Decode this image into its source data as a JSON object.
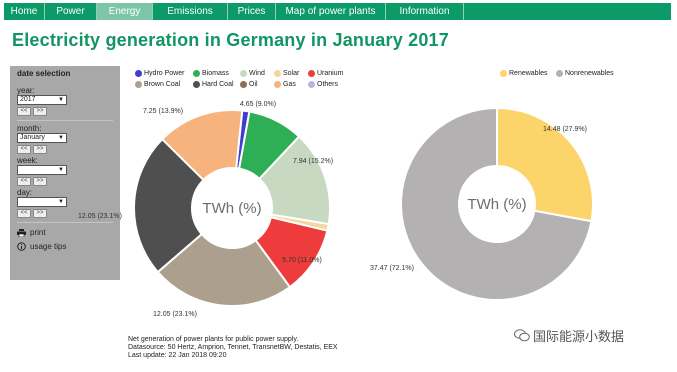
{
  "nav": {
    "items": [
      "Home",
      "Power",
      "Energy",
      "Emissions",
      "Prices",
      "Map of power plants",
      "Information"
    ],
    "active": "Energy"
  },
  "page": {
    "title": "Electricity generation in Germany in January 2017"
  },
  "sidebar": {
    "heading": "date selection",
    "year_label": "year:",
    "year_value": "2017",
    "month_label": "month:",
    "month_value": "January",
    "week_label": "week:",
    "week_value": "",
    "day_label": "day:",
    "day_value": "",
    "prev_label": "<<",
    "next_label": ">>",
    "print_label": "print",
    "usage_label": "usage tips"
  },
  "legend_left": [
    {
      "label": "Hydro Power",
      "color": "#3e3fcf"
    },
    {
      "label": "Biomass",
      "color": "#2eae55"
    },
    {
      "label": "Wind",
      "color": "#c8d9c2"
    },
    {
      "label": "Solar",
      "color": "#f4d79a"
    },
    {
      "label": "Uranium",
      "color": "#ee3b3b"
    },
    {
      "label": "Brown Coal",
      "color": "#ad9f8d"
    },
    {
      "label": "Hard Coal",
      "color": "#4f4f4f"
    },
    {
      "label": "Oil",
      "color": "#8e6c53"
    },
    {
      "label": "Gas",
      "color": "#f6b37e"
    },
    {
      "label": "Others",
      "color": "#b9b3e0"
    }
  ],
  "legend_right": [
    {
      "label": "Renewables",
      "color": "#fcd56a"
    },
    {
      "label": "Nonrenewables",
      "color": "#b3b1b1"
    }
  ],
  "chart_data": [
    {
      "type": "pie",
      "center_label": "TWh (%)",
      "slices": [
        {
          "name": "Hydro Power",
          "value": 0.6,
          "label": "",
          "color": "#3e3fcf"
        },
        {
          "name": "Biomass",
          "value": 4.65,
          "label": "4.65 (9.0%)",
          "color": "#2eae55"
        },
        {
          "name": "Wind",
          "value": 7.94,
          "label": "7.94 (15.2%)",
          "color": "#c8d9c2"
        },
        {
          "name": "Solar",
          "value": 0.55,
          "label": "",
          "color": "#f4d79a"
        },
        {
          "name": "Uranium",
          "value": 5.7,
          "label": "5.70 (11.0%)",
          "color": "#ee3b3b"
        },
        {
          "name": "Brown Coal",
          "value": 12.05,
          "label": "12.05 (23.1%)",
          "color": "#ad9f8d"
        },
        {
          "name": "Hard Coal",
          "value": 12.05,
          "label": "12.05 (23.1%)",
          "color": "#4f4f4f"
        },
        {
          "name": "Gas",
          "value": 7.25,
          "label": "7.25 (13.9%)",
          "color": "#f6b37e"
        }
      ]
    },
    {
      "type": "pie",
      "center_label": "TWh (%)",
      "slices": [
        {
          "name": "Renewables",
          "value": 14.48,
          "label": "14.48 (27.9%)",
          "color": "#fcd56a"
        },
        {
          "name": "Nonrenewables",
          "value": 37.47,
          "label": "37.47 (72.1%)",
          "color": "#b3b1b1"
        }
      ]
    }
  ],
  "footer": {
    "line1": "Net generation of power plants for public power supply.",
    "line2": "Datasource: 50 Hertz, Amprion, Tennet, TransnetBW, Destatis, EEX",
    "line3": "Last update: 22 Jan 2018 09:20"
  },
  "watermark": {
    "text": "国际能源小数据"
  }
}
